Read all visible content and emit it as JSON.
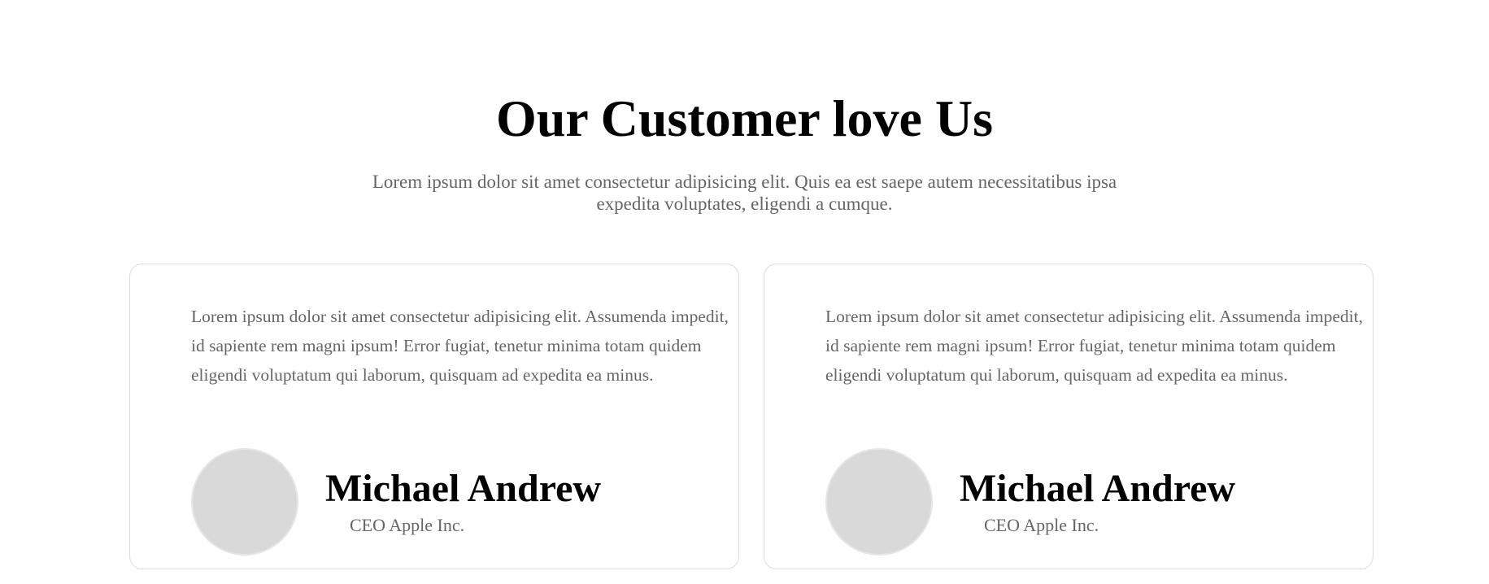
{
  "section": {
    "title": "Our Customer love Us",
    "subtitle": "Lorem ipsum dolor sit amet consectetur adipisicing elit. Quis ea est saepe autem necessitatibus ipsa expedita voluptates, eligendi a cumque."
  },
  "testimonials": [
    {
      "quote": "Lorem ipsum dolor sit amet consectetur adipisicing elit. Assumenda impedit, id sapiente rem magni ipsum! Error fugiat, tenetur minima totam quidem eligendi voluptatum qui laborum, quisquam ad expedita ea minus.",
      "name": "Michael Andrew",
      "role": "CEO Apple Inc."
    },
    {
      "quote": "Lorem ipsum dolor sit amet consectetur adipisicing elit. Assumenda impedit, id sapiente rem magni ipsum! Error fugiat, tenetur minima totam quidem eligendi voluptatum qui laborum, quisquam ad expedita ea minus.",
      "name": "Michael Andrew",
      "role": "CEO Apple Inc."
    }
  ],
  "colors": {
    "heading": "#000000",
    "body_text": "#666666",
    "card_border": "#dddddd",
    "avatar_placeholder": "#d9d9d9"
  }
}
